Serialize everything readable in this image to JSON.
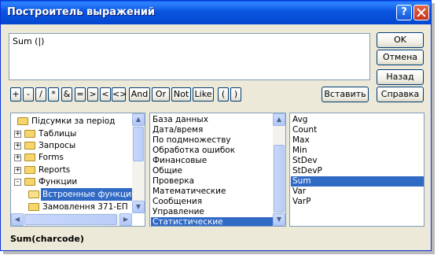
{
  "window": {
    "title": "Построитель выражений",
    "help_glyph": "?",
    "expression": "Sum (|)"
  },
  "buttons": {
    "ok": "OK",
    "cancel": "Отмена",
    "back": "Назад",
    "insert": "Вставить",
    "help": "Справка"
  },
  "operators": [
    "+",
    "-",
    "/",
    "*",
    "&",
    "=",
    ">",
    "<",
    "<>",
    "And",
    "Or",
    "Not",
    "Like",
    "(",
    ")"
  ],
  "tree": {
    "items": [
      {
        "label": "Підсумки за період",
        "expander": "",
        "icon": "folder-icon"
      },
      {
        "label": "Таблицы",
        "expander": "+",
        "icon": "folder-icon"
      },
      {
        "label": "Запросы",
        "expander": "+",
        "icon": "folder-icon"
      },
      {
        "label": "Forms",
        "expander": "+",
        "icon": "folder-icon"
      },
      {
        "label": "Reports",
        "expander": "+",
        "icon": "folder-icon"
      },
      {
        "label": "Функции",
        "expander": "-",
        "icon": "folder-icon"
      },
      {
        "label": "Встроенные функции",
        "expander": "",
        "icon": "open-folder-icon",
        "selected": true
      },
      {
        "label": "Замовлення 371-ЕП",
        "expander": "",
        "icon": "folder-icon"
      }
    ]
  },
  "categories": {
    "items": [
      "База данных",
      "Дата/время",
      "По подмножеству",
      "Обработка ошибок",
      "Финансовые",
      "Общие",
      "Проверка",
      "Математические",
      "Сообщения",
      "Управление",
      "Статистические"
    ],
    "selected_index": 10
  },
  "functions": {
    "items": [
      "Avg",
      "Count",
      "Max",
      "Min",
      "StDev",
      "StDevP",
      "Sum",
      "Var",
      "VarP"
    ],
    "selected_index": 6
  },
  "status": {
    "syntax": "Sum(charcode)"
  },
  "colors": {
    "title_bar": "#0a54e0",
    "selection": "#316ac5",
    "dialog_bg": "#ece9d8",
    "close_button": "#c4331a"
  }
}
